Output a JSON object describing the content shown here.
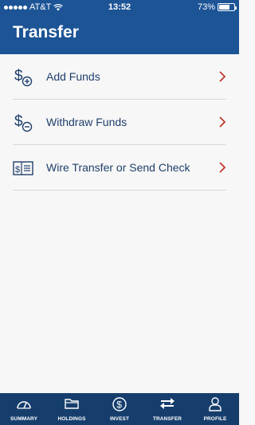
{
  "status_bar": {
    "carrier": "AT&T",
    "time": "13:52",
    "battery_percent": "73%",
    "battery_level": 0.73
  },
  "header": {
    "title": "Transfer"
  },
  "menu": [
    {
      "label": "Add Funds",
      "icon": "dollar-plus-icon"
    },
    {
      "label": "Withdraw Funds",
      "icon": "dollar-minus-icon"
    },
    {
      "label": "Wire Transfer or Send Check",
      "icon": "check-icon"
    }
  ],
  "tabs": [
    {
      "label": "SUMMARY",
      "icon": "gauge-icon"
    },
    {
      "label": "HOLDINGS",
      "icon": "folder-icon"
    },
    {
      "label": "INVEST",
      "icon": "dollar-circle-icon"
    },
    {
      "label": "TRANSFER",
      "icon": "transfer-arrows-icon",
      "active": true
    },
    {
      "label": "PROFILE",
      "icon": "person-icon"
    }
  ],
  "colors": {
    "brand": "#1c5496",
    "tabbar": "#163e6d",
    "chevron": "#c0392b",
    "accent_icon": "#1f3f6b"
  }
}
